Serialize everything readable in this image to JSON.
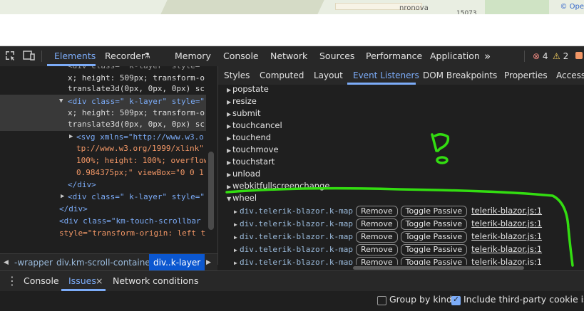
{
  "map": {
    "street_label": "nronova",
    "number_label": "15073",
    "copyright_link": "© Ope"
  },
  "toolbar": {
    "tabs": [
      "Elements",
      "Recorder",
      "Memory",
      "Console",
      "Network",
      "Sources",
      "Performance",
      "Application"
    ],
    "more_label": "»",
    "errors": "4",
    "warnings": "2"
  },
  "elements": {
    "lines": [
      "<div class=\" k-layer\" style=\"",
      "x; height: 509px; transform-o",
      "translate3d(0px, 0px, 0px) sc",
      "<div class=\" k-layer\" style=\"",
      "x; height: 509px; transform-o",
      "translate3d(0px, 0px, 0px) sc",
      "<svg xmlns=\"http://www.w3.o",
      "tp://www.w3.org/1999/xlink\"",
      "100%; height: 100%; overflow",
      "0.984375px;\" viewBox=\"0 0 1",
      "</div>",
      "<div class=\" k-layer\" style=\"",
      "</div>",
      "<div class=\"km-touch-scrollbar",
      "style=\"transform-origin: left t"
    ]
  },
  "breadcrumbs": [
    "-wrapper",
    "div.km-scroll-container",
    "div..k-layer"
  ],
  "right_tabs": [
    "Styles",
    "Computed",
    "Layout",
    "Event Listeners",
    "DOM Breakpoints",
    "Properties",
    "Accessi"
  ],
  "events": [
    "popstate",
    "resize",
    "submit",
    "touchcancel",
    "touchend",
    "touchmove",
    "touchstart",
    "unload",
    "webkitfullscreenchange",
    "wheel"
  ],
  "wheel_listeners": [
    {
      "node": "div.telerik-blazor.k-map",
      "remove": "Remove",
      "toggle": "Toggle Passive",
      "source": "telerik-blazor.js:1"
    },
    {
      "node": "div.telerik-blazor.k-map",
      "remove": "Remove",
      "toggle": "Toggle Passive",
      "source": "telerik-blazor.js:1"
    },
    {
      "node": "div.telerik-blazor.k-map",
      "remove": "Remove",
      "toggle": "Toggle Passive",
      "source": "telerik-blazor.js:1"
    },
    {
      "node": "div.telerik-blazor.k-map",
      "remove": "Remove",
      "toggle": "Toggle Passive",
      "source": "telerik-blazor.js:1"
    },
    {
      "node": "div.telerik-blazor.k-map",
      "remove": "Remove",
      "toggle": "Toggle Passive",
      "source": "telerik-blazor.js:1"
    }
  ],
  "drawer": {
    "tabs": [
      "Console",
      "Issues",
      "Network conditions"
    ],
    "close_label": "×",
    "group_by_kind": "Group by kind",
    "third_party": "Include third-party cookie issues"
  },
  "colors": {
    "accent": "#7cacf8",
    "annotation": "#33dd11",
    "error": "#f28b82",
    "warning": "#fdd663"
  }
}
